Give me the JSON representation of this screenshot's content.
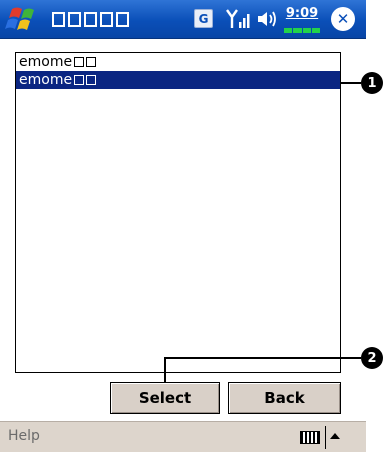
{
  "taskbar": {
    "title_boxes": 5,
    "g_label": "G",
    "time": "9:09",
    "icons": [
      "start-flag-icon",
      "g-icon",
      "signal-icon",
      "volume-icon",
      "close-icon"
    ],
    "close_glyph": "✕",
    "battery_segments": 4,
    "colors": {
      "bar": "#0a4fb8",
      "battery": "#22d24a"
    }
  },
  "list": {
    "items": [
      {
        "label": "emome",
        "boxes": 2,
        "selected": false
      },
      {
        "label": "emome",
        "boxes": 2,
        "selected": true
      }
    ],
    "selection_color": "#0a2582"
  },
  "callouts": {
    "one": "1",
    "two": "2"
  },
  "buttons": {
    "select": "Select",
    "back": "Back"
  },
  "cmdbar": {
    "help": "Help",
    "icons": [
      "keyboard-icon",
      "arrow-up-icon"
    ]
  }
}
